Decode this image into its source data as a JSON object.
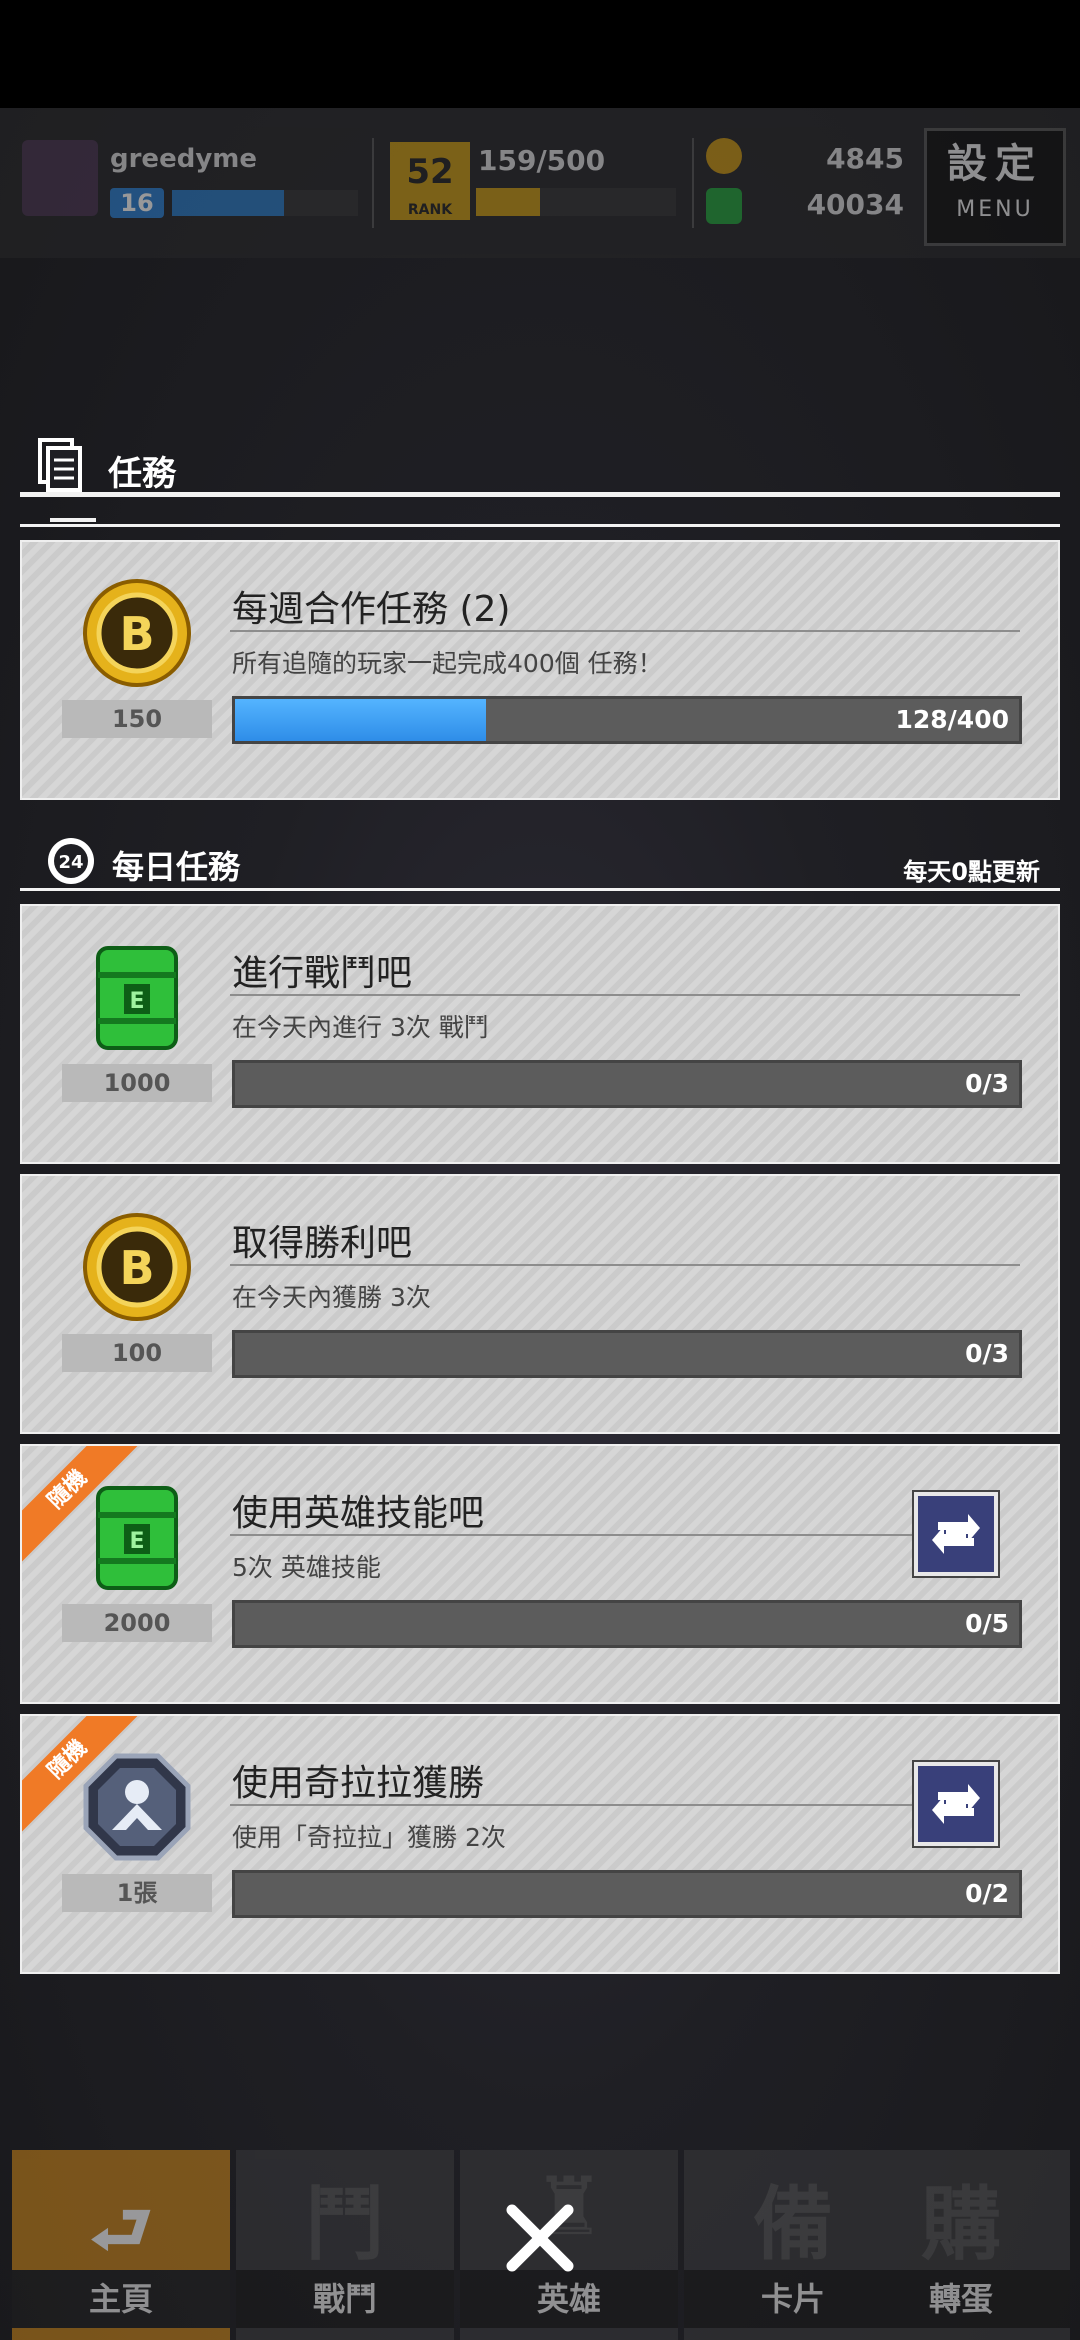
{
  "hud": {
    "player_name": "greedyme",
    "level": "16",
    "level_progress": 0.6,
    "rank_badge": "52",
    "rank_caption": "RANK",
    "rank_points": "159/500",
    "rank_progress": 0.32,
    "gold": "4845",
    "energy": "40034",
    "menu_title": "設定",
    "menu_caption": "MENU"
  },
  "missions_header": "任務",
  "weekly": {
    "title": "每週合作任務 (2)",
    "description": "所有追隨的玩家一起完成400個 任務！",
    "reward_icon": "gold-coin-icon",
    "reward_qty": "150",
    "progress_text": "128/400",
    "progress": 0.32
  },
  "daily_header": {
    "badge": "24",
    "title": "每日任務",
    "refresh_note": "每天0點更新"
  },
  "daily": [
    {
      "title": "進行戰鬥吧",
      "description": "在今天內進行 3次 戰鬥",
      "reward_icon": "energy-can-icon",
      "reward_qty": "1000",
      "progress_text": "0/3",
      "progress": 0,
      "random": false
    },
    {
      "title": "取得勝利吧",
      "description": "在今天內獲勝 3次",
      "reward_icon": "gold-coin-icon",
      "reward_qty": "100",
      "progress_text": "0/3",
      "progress": 0,
      "random": false
    },
    {
      "title": "使用英雄技能吧",
      "description": "5次 英雄技能",
      "reward_icon": "energy-can-icon",
      "reward_qty": "2000",
      "progress_text": "0/5",
      "progress": 0,
      "random": true
    },
    {
      "title": "使用奇拉拉獲勝",
      "description": "使用「奇拉拉」獲勝 2次",
      "reward_icon": "hero-ticket-icon",
      "reward_qty": "1張",
      "progress_text": "0/2",
      "progress": 0,
      "random": true
    }
  ],
  "random_ribbon": "隨機",
  "nav": [
    {
      "label": "主頁"
    },
    {
      "label": "戰鬥"
    },
    {
      "label": "英雄"
    },
    {
      "label": "卡片"
    },
    {
      "label": "轉蛋"
    }
  ],
  "nav_glyphs": [
    "",
    "鬥",
    "",
    "備",
    "購"
  ]
}
